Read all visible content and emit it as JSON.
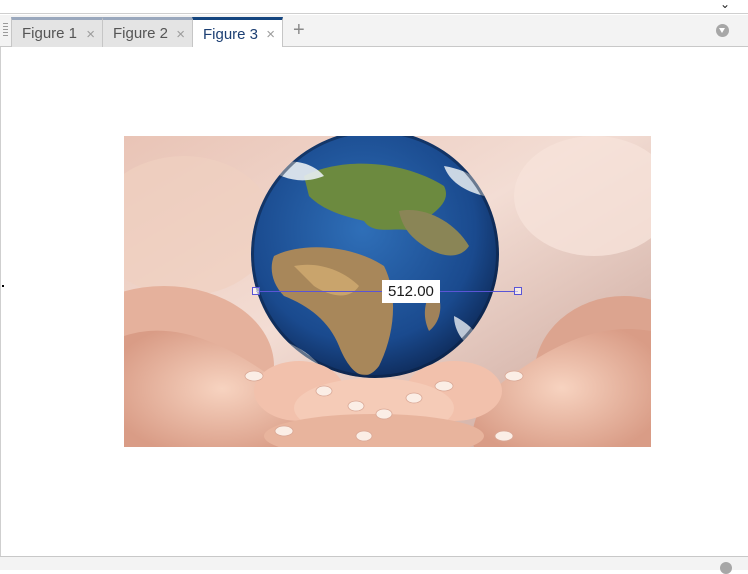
{
  "tabs": [
    {
      "label": "Figure 1",
      "close": "×",
      "active": false
    },
    {
      "label": "Figure 2",
      "close": "×",
      "active": false
    },
    {
      "label": "Figure 3",
      "close": "×",
      "active": true
    }
  ],
  "add_tab_label": "+",
  "measurement": {
    "value": "512.00"
  },
  "image": {
    "subject": "earth globe held in cupped hands"
  },
  "icons": {
    "grip": "drag-grip-icon",
    "close": "close-icon",
    "add": "plus-icon",
    "tab_menu": "chevron-down-circle-icon",
    "top_chevron": "chevron-down-icon"
  },
  "colors": {
    "active_tab_border": "#14457f",
    "inactive_tab_border": "#9aa8bd",
    "measure_line": "#5a55d6",
    "tab_bar_bg": "#f3f3f3"
  }
}
